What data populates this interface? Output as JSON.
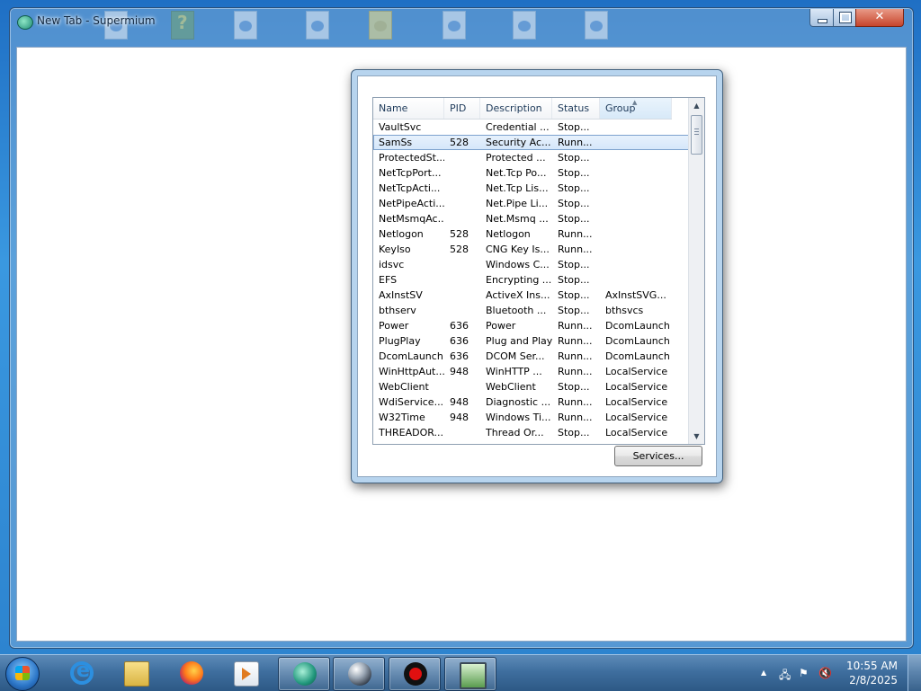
{
  "window": {
    "title": "New Tab - Supermium",
    "close_glyph": "✕"
  },
  "dialog": {
    "columns": {
      "name": "Name",
      "pid": "PID",
      "description": "Description",
      "status": "Status",
      "group": "Group"
    },
    "sort_glyph": "▲",
    "rows": [
      {
        "name": "VaultSvc",
        "pid": "",
        "description": "Credential ...",
        "status": "Stop...",
        "group": ""
      },
      {
        "name": "SamSs",
        "pid": "528",
        "description": "Security Ac...",
        "status": "Runn...",
        "group": ""
      },
      {
        "name": "ProtectedSt...",
        "pid": "",
        "description": "Protected ...",
        "status": "Stop...",
        "group": ""
      },
      {
        "name": "NetTcpPort...",
        "pid": "",
        "description": "Net.Tcp Po...",
        "status": "Stop...",
        "group": ""
      },
      {
        "name": "NetTcpActi...",
        "pid": "",
        "description": "Net.Tcp Lis...",
        "status": "Stop...",
        "group": ""
      },
      {
        "name": "NetPipeActi...",
        "pid": "",
        "description": "Net.Pipe Li...",
        "status": "Stop...",
        "group": ""
      },
      {
        "name": "NetMsmqAc...",
        "pid": "",
        "description": "Net.Msmq ...",
        "status": "Stop...",
        "group": ""
      },
      {
        "name": "Netlogon",
        "pid": "528",
        "description": "Netlogon",
        "status": "Runn...",
        "group": ""
      },
      {
        "name": "KeyIso",
        "pid": "528",
        "description": "CNG Key Is...",
        "status": "Runn...",
        "group": ""
      },
      {
        "name": "idsvc",
        "pid": "",
        "description": "Windows C...",
        "status": "Stop...",
        "group": ""
      },
      {
        "name": "EFS",
        "pid": "",
        "description": "Encrypting ...",
        "status": "Stop...",
        "group": ""
      },
      {
        "name": "AxInstSV",
        "pid": "",
        "description": "ActiveX Ins...",
        "status": "Stop...",
        "group": "AxInstSVG..."
      },
      {
        "name": "bthserv",
        "pid": "",
        "description": "Bluetooth ...",
        "status": "Stop...",
        "group": "bthsvcs"
      },
      {
        "name": "Power",
        "pid": "636",
        "description": "Power",
        "status": "Runn...",
        "group": "DcomLaunch"
      },
      {
        "name": "PlugPlay",
        "pid": "636",
        "description": "Plug and Play",
        "status": "Runn...",
        "group": "DcomLaunch"
      },
      {
        "name": "DcomLaunch",
        "pid": "636",
        "description": "DCOM Ser...",
        "status": "Runn...",
        "group": "DcomLaunch"
      },
      {
        "name": "WinHttpAut...",
        "pid": "948",
        "description": "WinHTTP ...",
        "status": "Runn...",
        "group": "LocalService"
      },
      {
        "name": "WebClient",
        "pid": "",
        "description": "WebClient",
        "status": "Stop...",
        "group": "LocalService"
      },
      {
        "name": "WdiService...",
        "pid": "948",
        "description": "Diagnostic ...",
        "status": "Runn...",
        "group": "LocalService"
      },
      {
        "name": "W32Time",
        "pid": "948",
        "description": "Windows Ti...",
        "status": "Runn...",
        "group": "LocalService"
      },
      {
        "name": "THREADOR...",
        "pid": "",
        "description": "Thread Or...",
        "status": "Stop...",
        "group": "LocalService"
      }
    ],
    "selected_row": 1,
    "scroll_up": "▲",
    "scroll_down": "▼",
    "services_button": "Services..."
  },
  "taskbar": {
    "apps": [
      "start-orb",
      "internet-explorer-icon",
      "file-explorer-icon",
      "firefox-icon",
      "media-player-icon",
      "supermium-icon",
      "sphere-icon",
      "record-icon",
      "monitor-icon"
    ],
    "tray": {
      "chevron": "▲",
      "network": "🖧",
      "flag": "⚑",
      "volume": "🔇"
    },
    "clock": {
      "time": "10:55 AM",
      "date": "2/8/2025"
    }
  }
}
